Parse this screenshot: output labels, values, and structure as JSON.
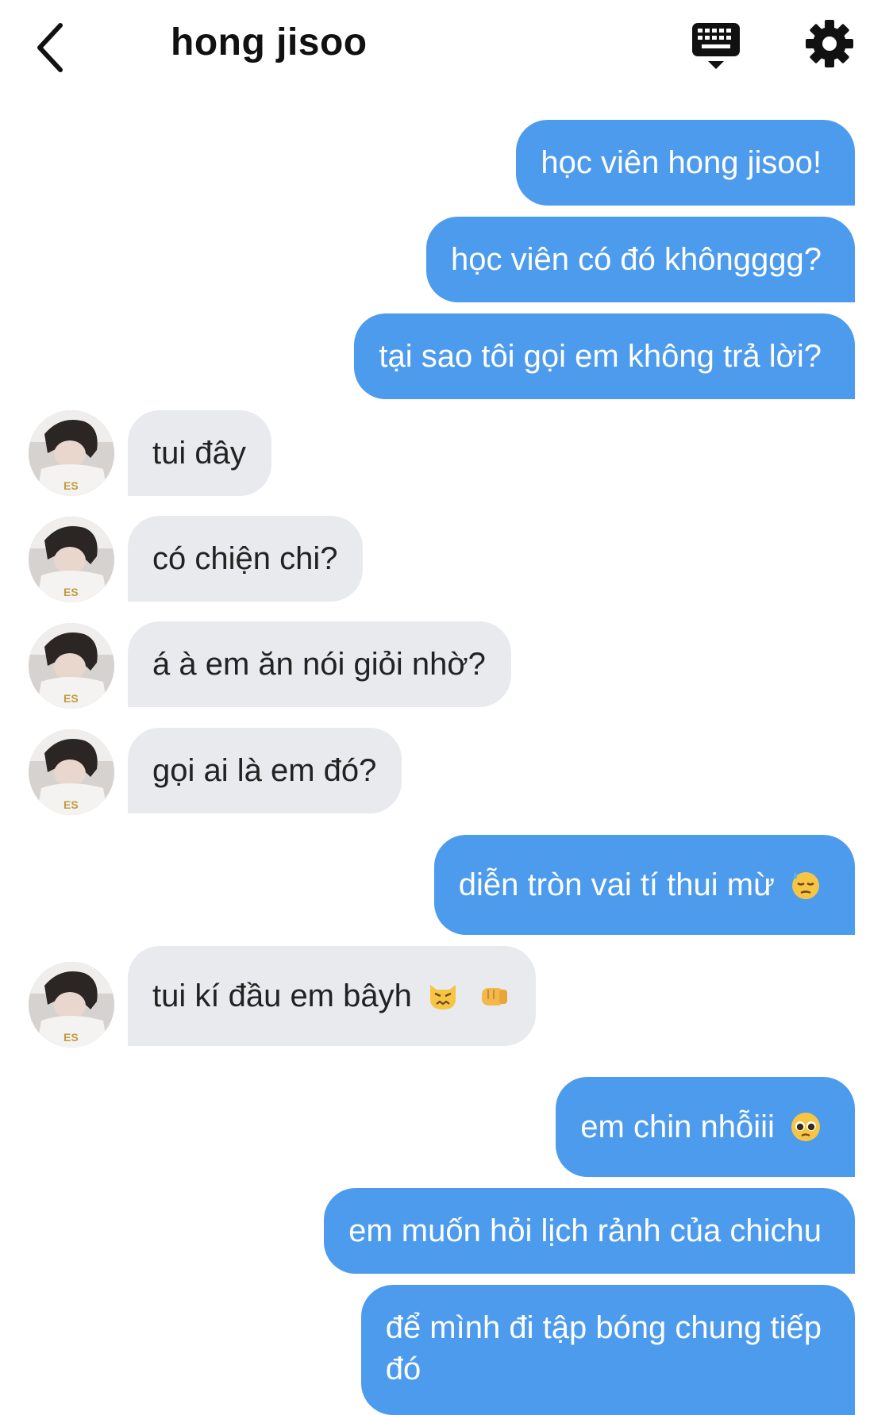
{
  "header": {
    "title": "hong jisoo",
    "back_icon": "chevron-left-icon",
    "keyboard_icon": "keyboard-icon",
    "settings_icon": "gear-icon"
  },
  "colors": {
    "outgoing_bubble": "#4d9bec",
    "incoming_bubble": "#e8eaed",
    "icon": "#111111"
  },
  "messages": [
    {
      "sender": "me",
      "text": "học viên hong jisoo!"
    },
    {
      "sender": "me",
      "text": "học viên có đó khôngggg?"
    },
    {
      "sender": "me",
      "text": "tại sao tôi gọi em không trả lời?"
    },
    {
      "sender": "them",
      "text": "tui đây"
    },
    {
      "sender": "them",
      "text": "có chiện chi?"
    },
    {
      "sender": "them",
      "text": "á à em ăn nói giỏi nhờ?"
    },
    {
      "sender": "them",
      "text": "gọi ai là em đó?"
    },
    {
      "sender": "me",
      "text": "diễn tròn vai tí thui mừ",
      "emoji": [
        "downcast-sweat-face-emoji"
      ]
    },
    {
      "sender": "them",
      "text": "tui kí đầu em bâyh",
      "emoji": [
        "angry-cat-emoji",
        "fist-bump-emoji"
      ]
    },
    {
      "sender": "me",
      "text": "em chin nhỗiii",
      "emoji": [
        "pleading-face-emoji"
      ]
    },
    {
      "sender": "me",
      "text": "em muốn hỏi lịch rảnh của chichu"
    },
    {
      "sender": "me",
      "text_line1": "để mình đi tập bóng chung tiếp",
      "text_line2": "đó"
    }
  ]
}
